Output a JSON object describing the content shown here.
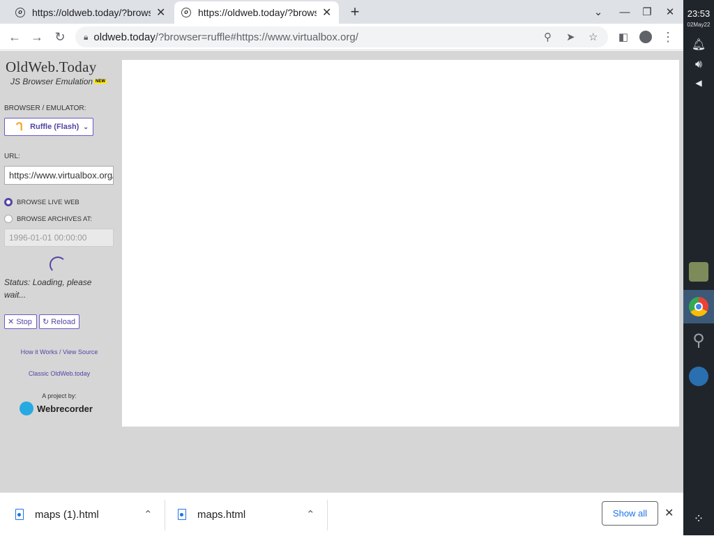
{
  "tabs": [
    {
      "title": "https://oldweb.today/?browser=ruffle#https://www.virtualbox.org/",
      "favicon_letter": "o"
    },
    {
      "title": "https://oldweb.today/?browser=ruffle#https://www.virtualbox.org/",
      "favicon_letter": "o"
    }
  ],
  "new_tab_label": "+",
  "address": {
    "host": "oldweb.today",
    "rest": "/?browser=ruffle#https://www.virtualbox.org/"
  },
  "page": {
    "logo": "OldWeb.Today",
    "subtitle": "JS Browser Emulation",
    "new_badge": "NEW",
    "emulator_label": "BROWSER / EMULATOR:",
    "emulator_value": "Ruffle (Flash)",
    "url_label": "URL:",
    "url_value": "https://www.virtualbox.org/",
    "radio_live": "BROWSE LIVE WEB",
    "radio_archives": "BROWSE ARCHIVES AT:",
    "date_value": "1996-01-01 00:00:00",
    "status": "Status: Loading, please wait...",
    "stop_label": "Stop",
    "reload_label": "Reload",
    "link_how": "How it Works / View Source",
    "link_classic": "Classic OldWeb.today",
    "project_by": "A project by:",
    "webrecorder": "Webrecorder"
  },
  "downloads": [
    {
      "name": "maps (1).html"
    },
    {
      "name": "maps.html"
    }
  ],
  "show_all_label": "Show all",
  "shelf": {
    "time": "23:53",
    "date": "02May22"
  },
  "colors": {
    "accent": "#5146a4",
    "panel": "#d6d6d6",
    "shelf": "#20252b",
    "chrome_blue": "#1a73e8"
  }
}
